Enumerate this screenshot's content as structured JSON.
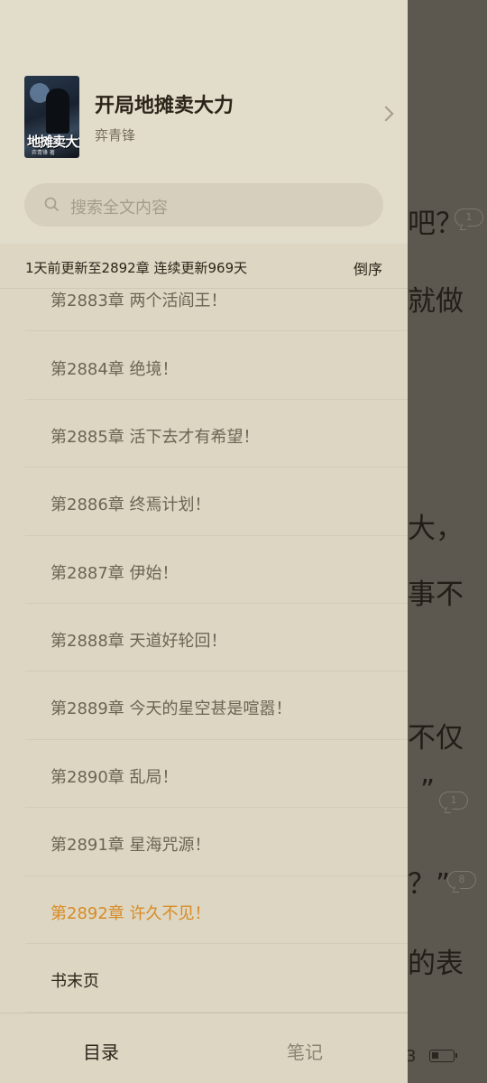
{
  "book": {
    "title": "开局地摊卖大力",
    "author": "弈青锋",
    "cover_title": "地摊卖大力",
    "cover_subtitle": "弈青锋 著"
  },
  "search": {
    "placeholder": "搜索全文内容"
  },
  "update_info": "1天前更新至2892章 连续更新969天",
  "sort_label": "倒序",
  "chapters": [
    {
      "label": "第2883章 两个活阎王！"
    },
    {
      "label": "第2884章 绝境！"
    },
    {
      "label": "第2885章 活下去才有希望！"
    },
    {
      "label": "第2886章 终焉计划！"
    },
    {
      "label": "第2887章 伊始！"
    },
    {
      "label": "第2888章 天道好轮回！"
    },
    {
      "label": "第2889章 今天的星空甚是喧嚣！"
    },
    {
      "label": "第2890章 乱局！"
    },
    {
      "label": "第2891章 星海咒源！"
    },
    {
      "label": "第2892章 许久不见！",
      "current": true
    },
    {
      "label": "书末页"
    }
  ],
  "tabs": {
    "toc": "目录",
    "notes": "笔记"
  },
  "reader": {
    "fragments": [
      "吧？",
      "就做",
      "大，",
      "事不",
      "不仅",
      "”",
      "？”",
      "的表"
    ],
    "comment_counts": [
      "1",
      "1",
      "8"
    ],
    "page_number": "3"
  },
  "colors": {
    "current_chapter": "#d88b25",
    "drawer_background": "#ddd6c2",
    "overlay": "#5c584f"
  }
}
